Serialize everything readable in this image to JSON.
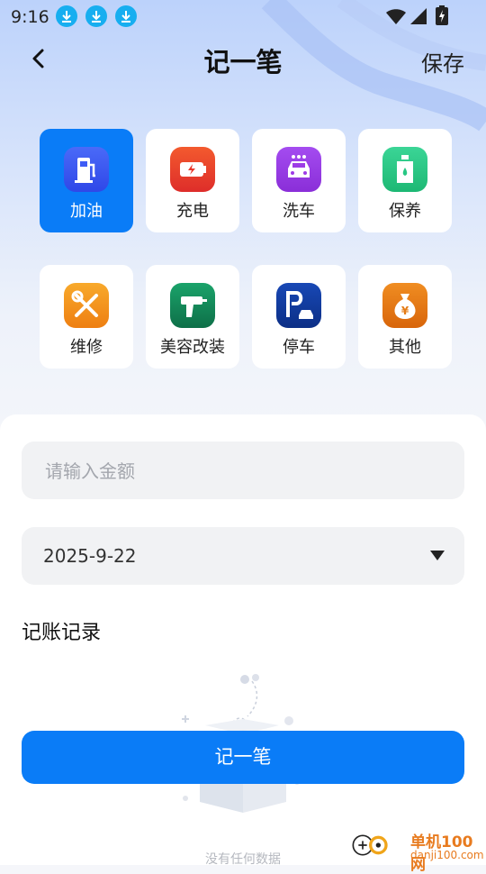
{
  "status_bar": {
    "time": "9:16",
    "notification_icons": [
      "download-icon",
      "download-icon",
      "download-icon"
    ],
    "system_icons": [
      "wifi-icon",
      "signal-icon",
      "battery-charging-icon"
    ]
  },
  "header": {
    "title": "记一笔",
    "save_label": "保存",
    "back_icon": "chevron-left-icon"
  },
  "categories": [
    {
      "label": "加油",
      "icon": "fuel-pump-icon",
      "color": "#3e5cf5",
      "selected": true
    },
    {
      "label": "充电",
      "icon": "battery-charge-icon",
      "color": "#f0432d",
      "selected": false
    },
    {
      "label": "洗车",
      "icon": "car-wash-icon",
      "color": "#9d3be6",
      "selected": false
    },
    {
      "label": "保养",
      "icon": "oil-can-icon",
      "color": "#27c783",
      "selected": false
    },
    {
      "label": "维修",
      "icon": "wrench-screwdriver-icon",
      "color": "#f59a1c",
      "selected": false
    },
    {
      "label": "美容改装",
      "icon": "drill-icon",
      "color": "#138a5a",
      "selected": false
    },
    {
      "label": "停车",
      "icon": "parking-icon",
      "color": "#0f3a9a",
      "selected": false
    },
    {
      "label": "其他",
      "icon": "money-bag-icon",
      "color": "#e47b15",
      "selected": false
    }
  ],
  "form": {
    "amount_placeholder": "请输入金额",
    "date_value": "2025-9-22"
  },
  "records": {
    "section_title": "记账记录",
    "empty_text": "没有任何数据"
  },
  "submit_label": "记一笔",
  "watermark": {
    "name": "单机100网",
    "url": "danji100.com"
  },
  "colors": {
    "accent": "#0a7cf7",
    "field_bg": "#f1f2f4"
  }
}
